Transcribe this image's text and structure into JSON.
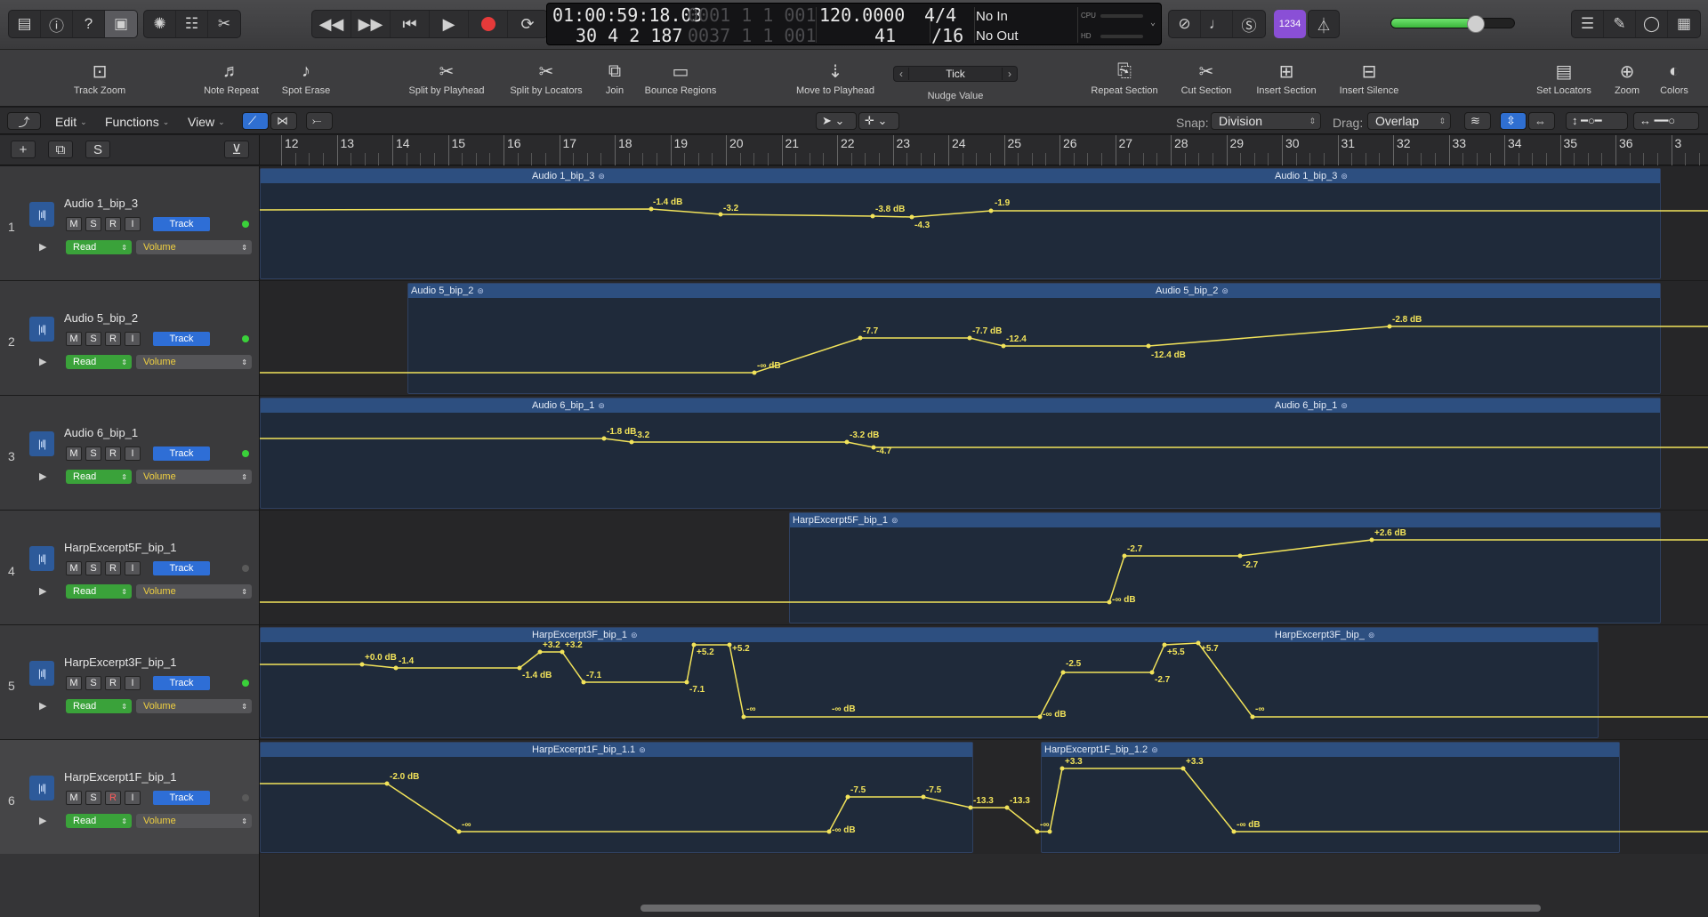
{
  "control_bar": {
    "left_buttons": [
      "library-icon",
      "info-icon",
      "help-icon",
      "toolbar-icon"
    ],
    "edit_buttons": [
      "smart-controls-icon",
      "mixer-icon",
      "editors-icon"
    ],
    "lcd": {
      "time": "01:00:59:18.03",
      "bar_position": "30 4 2 187",
      "locator_top": "0001  1  1  001",
      "locator_bottom": "0037  1  1  001",
      "tempo": "120.0000",
      "tempo_sub": "41",
      "signature": "4/4",
      "division": "/16",
      "midi_in": "No In",
      "midi_out": "No Out",
      "cpu_label": "CPU",
      "hd_label": "HD"
    },
    "count_in": "1234",
    "master_volume_fraction": 0.68
  },
  "toolbar": {
    "items": [
      {
        "label": "Track Zoom",
        "icon": "track-zoom-icon",
        "glyph": "⊡"
      },
      {
        "label": "Note Repeat",
        "icon": "note-repeat-icon",
        "glyph": "♬"
      },
      {
        "label": "Spot Erase",
        "icon": "spot-erase-icon",
        "glyph": "♪"
      },
      {
        "label": "Split by Playhead",
        "icon": "split-playhead-icon",
        "glyph": "✂"
      },
      {
        "label": "Split by Locators",
        "icon": "split-locators-icon",
        "glyph": "✂"
      },
      {
        "label": "Join",
        "icon": "join-icon",
        "glyph": "⧉"
      },
      {
        "label": "Bounce Regions",
        "icon": "bounce-regions-icon",
        "glyph": "▭"
      },
      {
        "label": "Move to Playhead",
        "icon": "move-playhead-icon",
        "glyph": "⇣"
      },
      {
        "label": "Repeat Section",
        "icon": "repeat-section-icon",
        "glyph": "⎘"
      },
      {
        "label": "Cut Section",
        "icon": "cut-section-icon",
        "glyph": "✂"
      },
      {
        "label": "Insert Section",
        "icon": "insert-section-icon",
        "glyph": "⊞"
      },
      {
        "label": "Insert Silence",
        "icon": "insert-silence-icon",
        "glyph": "⊟"
      },
      {
        "label": "Set Locators",
        "icon": "set-locators-icon",
        "glyph": "▤"
      },
      {
        "label": "Zoom",
        "icon": "zoom-icon",
        "glyph": "⊕"
      },
      {
        "label": "Colors",
        "icon": "colors-icon",
        "glyph": "◐"
      }
    ],
    "nudge": {
      "value": "Tick",
      "label": "Nudge Value"
    }
  },
  "tracks_bar": {
    "menus": [
      "Edit",
      "Functions",
      "View"
    ],
    "snap_label": "Snap:",
    "snap_value": "Division",
    "drag_label": "Drag:",
    "drag_value": "Overlap"
  },
  "ruler": {
    "bars": [
      "12",
      "13",
      "14",
      "15",
      "16",
      "17",
      "18",
      "19",
      "20",
      "21",
      "22",
      "23",
      "24",
      "25",
      "26",
      "27",
      "28",
      "29",
      "30",
      "31",
      "32",
      "33",
      "34",
      "35",
      "36",
      "3"
    ]
  },
  "tracks": [
    {
      "number": "1",
      "name": "Audio 1_bip_3",
      "mode": "Read",
      "param": "Volume",
      "led": true,
      "regions": [
        {
          "start": 0,
          "end": 1575,
          "names": [
            {
              "text": "Audio 1_bip_3",
              "at": 305
            },
            {
              "text": "Audio 1_bip_3",
              "at": 1140
            }
          ]
        }
      ],
      "automation": {
        "points": [
          [
            0,
            49
          ],
          [
            440,
            48
          ],
          [
            518,
            54
          ],
          [
            689,
            56
          ],
          [
            733,
            57
          ],
          [
            822,
            50
          ],
          [
            1628,
            50
          ]
        ],
        "dots": [
          1,
          2,
          3,
          4,
          5
        ]
      },
      "labels": [
        [
          "-1.4 dB",
          442,
          35
        ],
        [
          "-3.2",
          521,
          42
        ],
        [
          "-3.8 dB",
          692,
          43
        ],
        [
          "-4.3",
          736,
          61
        ],
        [
          "-1.9",
          826,
          36
        ]
      ]
    },
    {
      "number": "2",
      "name": "Audio 5_bip_2",
      "mode": "Read",
      "param": "Volume",
      "led": true,
      "regions": [
        {
          "start": 166,
          "end": 1575,
          "names": [
            {
              "text": "Audio 5_bip_2",
              "at": 3
            },
            {
              "text": "Audio 5_bip_2",
              "at": 840
            }
          ]
        }
      ],
      "automation": {
        "points": [
          [
            0,
            103
          ],
          [
            556,
            103
          ],
          [
            675,
            64
          ],
          [
            798,
            64
          ],
          [
            836,
            73
          ],
          [
            999,
            73
          ],
          [
            1270,
            51
          ],
          [
            1628,
            51
          ]
        ],
        "dots": [
          1,
          2,
          3,
          4,
          5,
          6
        ]
      },
      "labels": [
        [
          "-∞ dB",
          559,
          90
        ],
        [
          "-7.7",
          678,
          51
        ],
        [
          "-7.7 dB",
          801,
          51
        ],
        [
          "-12.4",
          839,
          60
        ],
        [
          "-12.4 dB",
          1002,
          78
        ],
        [
          "-2.8 dB",
          1273,
          38
        ]
      ]
    },
    {
      "number": "3",
      "name": "Audio 6_bip_1",
      "mode": "Read",
      "param": "Volume",
      "led": true,
      "regions": [
        {
          "start": 0,
          "end": 1575,
          "names": [
            {
              "text": "Audio 6_bip_1",
              "at": 305
            },
            {
              "text": "Audio 6_bip_1",
              "at": 1140
            }
          ]
        }
      ],
      "automation": {
        "points": [
          [
            0,
            48
          ],
          [
            387,
            48
          ],
          [
            418,
            52
          ],
          [
            660,
            52
          ],
          [
            690,
            58
          ],
          [
            1628,
            58
          ]
        ],
        "dots": [
          1,
          2,
          3,
          4
        ]
      },
      "labels": [
        [
          "-1.8 dB",
          390,
          35
        ],
        [
          "-3.2",
          421,
          39
        ],
        [
          "-3.2 dB",
          663,
          39
        ],
        [
          "-4.7",
          693,
          57
        ]
      ]
    },
    {
      "number": "4",
      "name": "HarpExcerpt5F_bip_1",
      "mode": "Read",
      "param": "Volume",
      "led": false,
      "regions": [
        {
          "start": 595,
          "end": 1575,
          "names": [
            {
              "text": "HarpExcerpt5F_bip_1",
              "at": 3
            }
          ]
        }
      ],
      "automation": {
        "points": [
          [
            0,
            103
          ],
          [
            955,
            103
          ],
          [
            972,
            51
          ],
          [
            1102,
            51
          ],
          [
            1250,
            33
          ],
          [
            1628,
            33
          ]
        ],
        "dots": [
          1,
          2,
          3,
          4
        ]
      },
      "labels": [
        [
          "-∞ dB",
          958,
          95
        ],
        [
          "-2.7",
          975,
          38
        ],
        [
          "-2.7",
          1105,
          56
        ],
        [
          "+2.6 dB",
          1253,
          20
        ]
      ]
    },
    {
      "number": "5",
      "name": "HarpExcerpt3F_bip_1",
      "mode": "Read",
      "param": "Volume",
      "led": true,
      "regions": [
        {
          "start": 0,
          "end": 1505,
          "names": [
            {
              "text": "HarpExcerpt3F_bip_1",
              "at": 305
            },
            {
              "text": "HarpExcerpt3F_bip_",
              "at": 1140
            }
          ]
        }
      ],
      "automation": {
        "points": [
          [
            0,
            44
          ],
          [
            115,
            44
          ],
          [
            153,
            48
          ],
          [
            292,
            48
          ],
          [
            315,
            30
          ],
          [
            340,
            30
          ],
          [
            364,
            64
          ],
          [
            480,
            64
          ],
          [
            488,
            22
          ],
          [
            528,
            22
          ],
          [
            544,
            103
          ],
          [
            877,
            103
          ],
          [
            903,
            53
          ],
          [
            1003,
            53
          ],
          [
            1017,
            22
          ],
          [
            1055,
            20
          ],
          [
            1116,
            103
          ],
          [
            1628,
            103
          ]
        ],
        "dots": [
          1,
          2,
          3,
          4,
          5,
          6,
          7,
          8,
          9,
          10,
          11,
          12,
          13,
          14,
          15,
          16
        ]
      },
      "labels": [
        [
          "+0.0 dB",
          118,
          31
        ],
        [
          "-1.4",
          156,
          35
        ],
        [
          "+3.2",
          318,
          17
        ],
        [
          "+3.2",
          343,
          17
        ],
        [
          "-1.4 dB",
          295,
          51
        ],
        [
          "-7.1",
          367,
          51
        ],
        [
          "+5.2",
          491,
          25
        ],
        [
          "+5.2",
          531,
          21
        ],
        [
          "-7.1",
          483,
          67
        ],
        [
          "-∞",
          547,
          89
        ],
        [
          "-∞ dB",
          643,
          89
        ],
        [
          "-2.5",
          906,
          38
        ],
        [
          "-2.7",
          1006,
          56
        ],
        [
          "+5.5",
          1020,
          25
        ],
        [
          "+5.7",
          1058,
          21
        ],
        [
          "-∞ dB",
          880,
          95
        ],
        [
          "-∞",
          1119,
          89
        ]
      ]
    },
    {
      "number": "6",
      "name": "HarpExcerpt1F_bip_1",
      "mode": "Read",
      "param": "Volume",
      "led": false,
      "selected": true,
      "rec_armed": true,
      "regions": [
        {
          "start": 0,
          "end": 802,
          "names": [
            {
              "text": "HarpExcerpt1F_bip_1.1",
              "at": 305
            }
          ]
        },
        {
          "start": 878,
          "end": 1529,
          "names": [
            {
              "text": "HarpExcerpt1F_bip_1.2",
              "at": 3
            }
          ]
        }
      ],
      "automation": {
        "points": [
          [
            0,
            49
          ],
          [
            143,
            49
          ],
          [
            224,
            103
          ],
          [
            640,
            103
          ],
          [
            661,
            64
          ],
          [
            746,
            64
          ],
          [
            799,
            76
          ],
          [
            840,
            76
          ],
          [
            874,
            103
          ],
          [
            888,
            103
          ],
          [
            902,
            32
          ],
          [
            1038,
            32
          ],
          [
            1095,
            103
          ],
          [
            1628,
            103
          ]
        ],
        "dots": [
          1,
          2,
          3,
          4,
          5,
          6,
          7,
          8,
          9,
          10,
          11,
          12
        ]
      },
      "labels": [
        [
          "-2.0 dB",
          146,
          36
        ],
        [
          "-∞",
          227,
          90
        ],
        [
          "-∞ dB",
          643,
          96
        ],
        [
          "-7.5",
          664,
          51
        ],
        [
          "-7.5",
          749,
          51
        ],
        [
          "-13.3",
          802,
          63
        ],
        [
          "-13.3",
          843,
          63
        ],
        [
          "-∞",
          877,
          90
        ],
        [
          "+3.3",
          905,
          19
        ],
        [
          "+3.3",
          1041,
          19
        ],
        [
          "-∞ dB",
          1098,
          90
        ]
      ]
    }
  ]
}
